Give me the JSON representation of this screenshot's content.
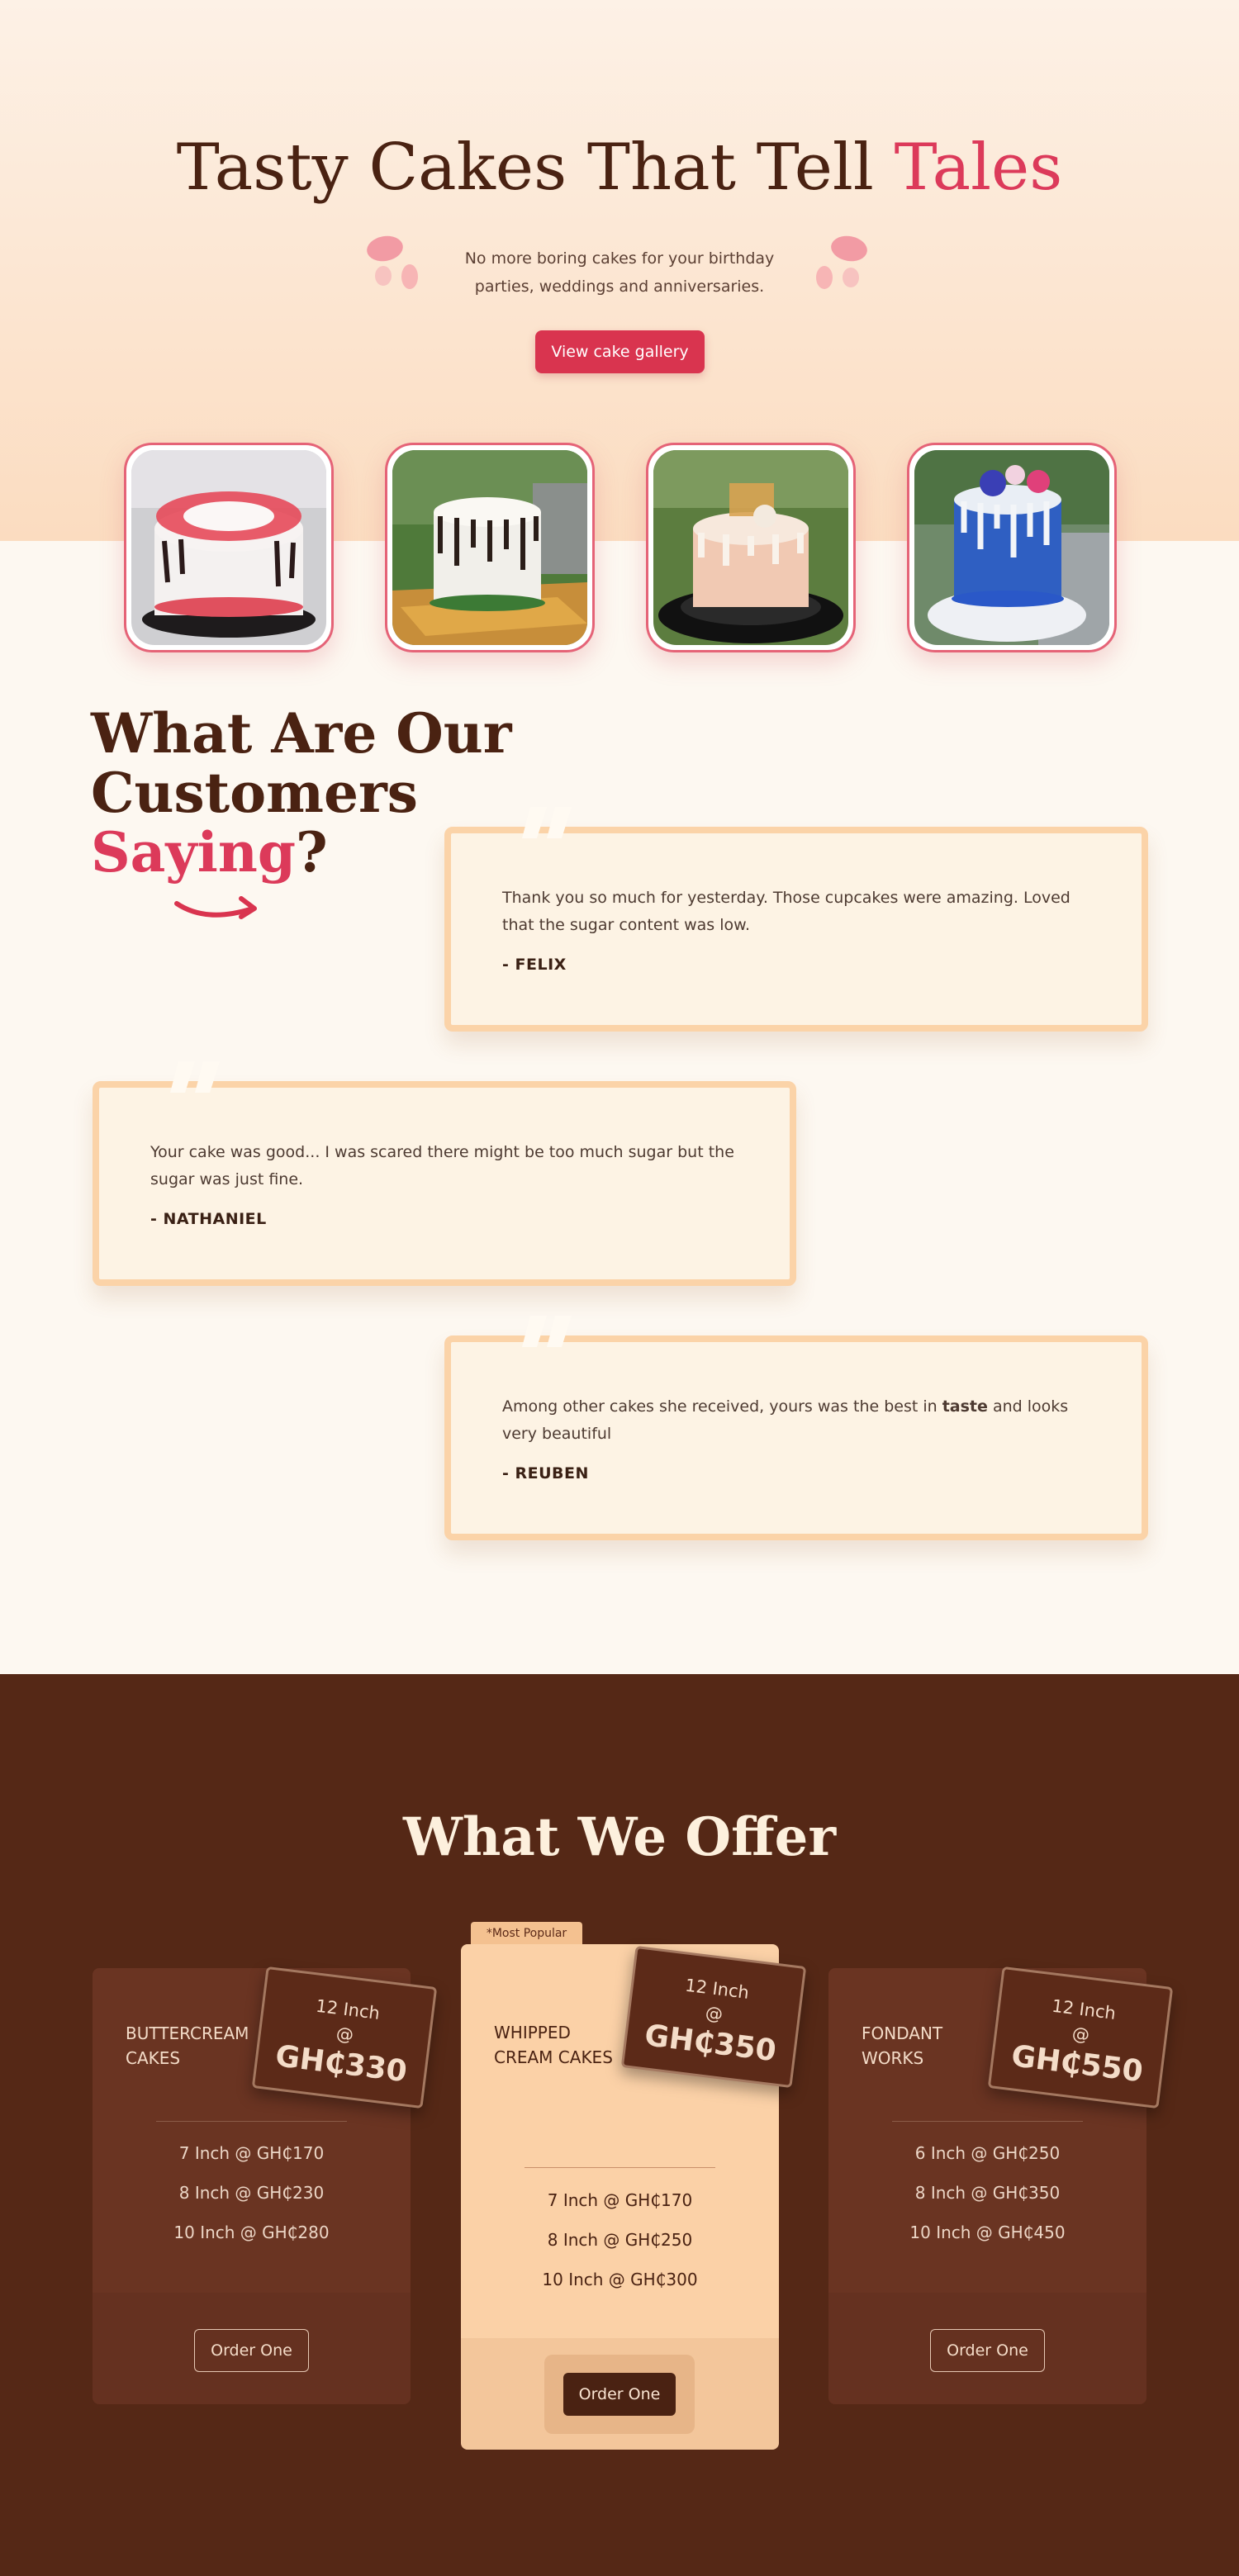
{
  "hero": {
    "title_main": "Tasty Cakes That Tell ",
    "title_accent": "Tales",
    "subtitle": "No more boring cakes for your birthday parties, weddings and anniversaries.",
    "cta": "View cake gallery"
  },
  "gallery": {
    "cakes": [
      {
        "alt": "Red and white frosted cake"
      },
      {
        "alt": "White drip cake with green decorations"
      },
      {
        "alt": "Peach drip cake with gold topper"
      },
      {
        "alt": "Blue drip cake with flowers"
      }
    ]
  },
  "testimonials": {
    "heading_line1": "What Are Our",
    "heading_line2": "Customers",
    "heading_accent": "Saying",
    "heading_end": "?",
    "items": [
      {
        "text": "Thank you so much for yesterday. Those cupcakes were amazing. Loved that the sugar content was low.",
        "author": "- FELIX"
      },
      {
        "text": "Your cake was good... I was scared there might be too much sugar but the sugar was just fine.",
        "author": "- NATHANIEL"
      },
      {
        "text_before": "Among other cakes she received, yours was the best in ",
        "text_bold": "taste",
        "text_after": " and looks very beautiful",
        "author": "- REUBEN"
      }
    ]
  },
  "offer": {
    "title": "What We Offer",
    "popular_label": "*Most Popular",
    "plans": [
      {
        "name": "BUTTERCREAM CAKES",
        "tag_size": "12 Inch",
        "tag_at": "@",
        "tag_price": "GH₵330",
        "prices": [
          "7 Inch @ GH₵170",
          "8 Inch @ GH₵230",
          "10 Inch @ GH₵280"
        ],
        "cta": "Order One"
      },
      {
        "name": "WHIPPED CREAM CAKES",
        "tag_size": "12 Inch",
        "tag_at": "@",
        "tag_price": "GH₵350",
        "prices": [
          "7 Inch @ GH₵170",
          "8 Inch @ GH₵250",
          "10 Inch @ GH₵300"
        ],
        "cta": "Order One"
      },
      {
        "name": "FONDANT WORKS",
        "tag_size": "12 Inch",
        "tag_at": "@",
        "tag_price": "GH₵550",
        "prices": [
          "6 Inch @ GH₵250",
          "8 Inch @ GH₵350",
          "10 Inch @ GH₵450"
        ],
        "cta": "Order One"
      }
    ]
  },
  "colors": {
    "brand_red": "#dc3a5a",
    "brown_dark": "#552816",
    "peach": "#fbd1a7"
  }
}
